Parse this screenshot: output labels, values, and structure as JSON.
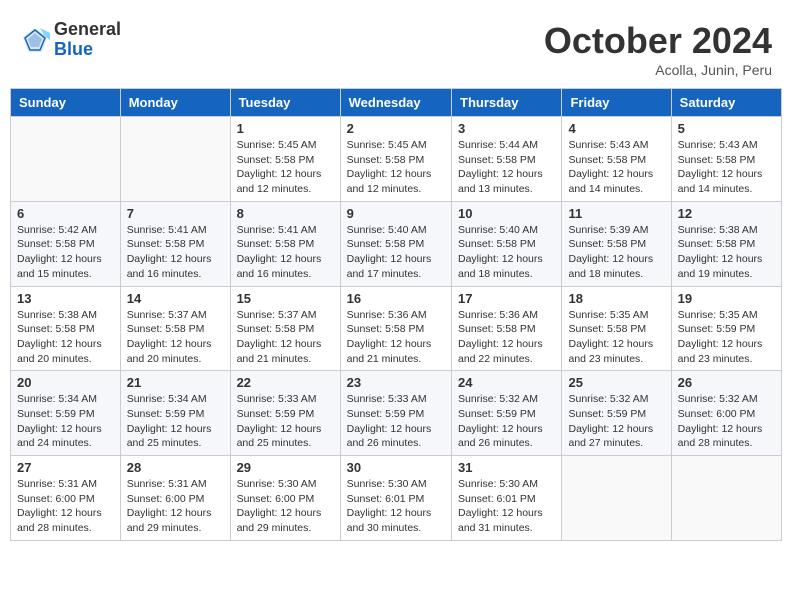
{
  "header": {
    "logo_general": "General",
    "logo_blue": "Blue",
    "month_title": "October 2024",
    "location": "Acolla, Junin, Peru"
  },
  "weekdays": [
    "Sunday",
    "Monday",
    "Tuesday",
    "Wednesday",
    "Thursday",
    "Friday",
    "Saturday"
  ],
  "weeks": [
    [
      {
        "day": "",
        "sunrise": "",
        "sunset": "",
        "daylight": "",
        "empty": true
      },
      {
        "day": "",
        "sunrise": "",
        "sunset": "",
        "daylight": "",
        "empty": true
      },
      {
        "day": "1",
        "sunrise": "Sunrise: 5:45 AM",
        "sunset": "Sunset: 5:58 PM",
        "daylight": "Daylight: 12 hours and 12 minutes."
      },
      {
        "day": "2",
        "sunrise": "Sunrise: 5:45 AM",
        "sunset": "Sunset: 5:58 PM",
        "daylight": "Daylight: 12 hours and 12 minutes."
      },
      {
        "day": "3",
        "sunrise": "Sunrise: 5:44 AM",
        "sunset": "Sunset: 5:58 PM",
        "daylight": "Daylight: 12 hours and 13 minutes."
      },
      {
        "day": "4",
        "sunrise": "Sunrise: 5:43 AM",
        "sunset": "Sunset: 5:58 PM",
        "daylight": "Daylight: 12 hours and 14 minutes."
      },
      {
        "day": "5",
        "sunrise": "Sunrise: 5:43 AM",
        "sunset": "Sunset: 5:58 PM",
        "daylight": "Daylight: 12 hours and 14 minutes."
      }
    ],
    [
      {
        "day": "6",
        "sunrise": "Sunrise: 5:42 AM",
        "sunset": "Sunset: 5:58 PM",
        "daylight": "Daylight: 12 hours and 15 minutes."
      },
      {
        "day": "7",
        "sunrise": "Sunrise: 5:41 AM",
        "sunset": "Sunset: 5:58 PM",
        "daylight": "Daylight: 12 hours and 16 minutes."
      },
      {
        "day": "8",
        "sunrise": "Sunrise: 5:41 AM",
        "sunset": "Sunset: 5:58 PM",
        "daylight": "Daylight: 12 hours and 16 minutes."
      },
      {
        "day": "9",
        "sunrise": "Sunrise: 5:40 AM",
        "sunset": "Sunset: 5:58 PM",
        "daylight": "Daylight: 12 hours and 17 minutes."
      },
      {
        "day": "10",
        "sunrise": "Sunrise: 5:40 AM",
        "sunset": "Sunset: 5:58 PM",
        "daylight": "Daylight: 12 hours and 18 minutes."
      },
      {
        "day": "11",
        "sunrise": "Sunrise: 5:39 AM",
        "sunset": "Sunset: 5:58 PM",
        "daylight": "Daylight: 12 hours and 18 minutes."
      },
      {
        "day": "12",
        "sunrise": "Sunrise: 5:38 AM",
        "sunset": "Sunset: 5:58 PM",
        "daylight": "Daylight: 12 hours and 19 minutes."
      }
    ],
    [
      {
        "day": "13",
        "sunrise": "Sunrise: 5:38 AM",
        "sunset": "Sunset: 5:58 PM",
        "daylight": "Daylight: 12 hours and 20 minutes."
      },
      {
        "day": "14",
        "sunrise": "Sunrise: 5:37 AM",
        "sunset": "Sunset: 5:58 PM",
        "daylight": "Daylight: 12 hours and 20 minutes."
      },
      {
        "day": "15",
        "sunrise": "Sunrise: 5:37 AM",
        "sunset": "Sunset: 5:58 PM",
        "daylight": "Daylight: 12 hours and 21 minutes."
      },
      {
        "day": "16",
        "sunrise": "Sunrise: 5:36 AM",
        "sunset": "Sunset: 5:58 PM",
        "daylight": "Daylight: 12 hours and 21 minutes."
      },
      {
        "day": "17",
        "sunrise": "Sunrise: 5:36 AM",
        "sunset": "Sunset: 5:58 PM",
        "daylight": "Daylight: 12 hours and 22 minutes."
      },
      {
        "day": "18",
        "sunrise": "Sunrise: 5:35 AM",
        "sunset": "Sunset: 5:58 PM",
        "daylight": "Daylight: 12 hours and 23 minutes."
      },
      {
        "day": "19",
        "sunrise": "Sunrise: 5:35 AM",
        "sunset": "Sunset: 5:59 PM",
        "daylight": "Daylight: 12 hours and 23 minutes."
      }
    ],
    [
      {
        "day": "20",
        "sunrise": "Sunrise: 5:34 AM",
        "sunset": "Sunset: 5:59 PM",
        "daylight": "Daylight: 12 hours and 24 minutes."
      },
      {
        "day": "21",
        "sunrise": "Sunrise: 5:34 AM",
        "sunset": "Sunset: 5:59 PM",
        "daylight": "Daylight: 12 hours and 25 minutes."
      },
      {
        "day": "22",
        "sunrise": "Sunrise: 5:33 AM",
        "sunset": "Sunset: 5:59 PM",
        "daylight": "Daylight: 12 hours and 25 minutes."
      },
      {
        "day": "23",
        "sunrise": "Sunrise: 5:33 AM",
        "sunset": "Sunset: 5:59 PM",
        "daylight": "Daylight: 12 hours and 26 minutes."
      },
      {
        "day": "24",
        "sunrise": "Sunrise: 5:32 AM",
        "sunset": "Sunset: 5:59 PM",
        "daylight": "Daylight: 12 hours and 26 minutes."
      },
      {
        "day": "25",
        "sunrise": "Sunrise: 5:32 AM",
        "sunset": "Sunset: 5:59 PM",
        "daylight": "Daylight: 12 hours and 27 minutes."
      },
      {
        "day": "26",
        "sunrise": "Sunrise: 5:32 AM",
        "sunset": "Sunset: 6:00 PM",
        "daylight": "Daylight: 12 hours and 28 minutes."
      }
    ],
    [
      {
        "day": "27",
        "sunrise": "Sunrise: 5:31 AM",
        "sunset": "Sunset: 6:00 PM",
        "daylight": "Daylight: 12 hours and 28 minutes."
      },
      {
        "day": "28",
        "sunrise": "Sunrise: 5:31 AM",
        "sunset": "Sunset: 6:00 PM",
        "daylight": "Daylight: 12 hours and 29 minutes."
      },
      {
        "day": "29",
        "sunrise": "Sunrise: 5:30 AM",
        "sunset": "Sunset: 6:00 PM",
        "daylight": "Daylight: 12 hours and 29 minutes."
      },
      {
        "day": "30",
        "sunrise": "Sunrise: 5:30 AM",
        "sunset": "Sunset: 6:01 PM",
        "daylight": "Daylight: 12 hours and 30 minutes."
      },
      {
        "day": "31",
        "sunrise": "Sunrise: 5:30 AM",
        "sunset": "Sunset: 6:01 PM",
        "daylight": "Daylight: 12 hours and 31 minutes."
      },
      {
        "day": "",
        "sunrise": "",
        "sunset": "",
        "daylight": "",
        "empty": true
      },
      {
        "day": "",
        "sunrise": "",
        "sunset": "",
        "daylight": "",
        "empty": true
      }
    ]
  ]
}
